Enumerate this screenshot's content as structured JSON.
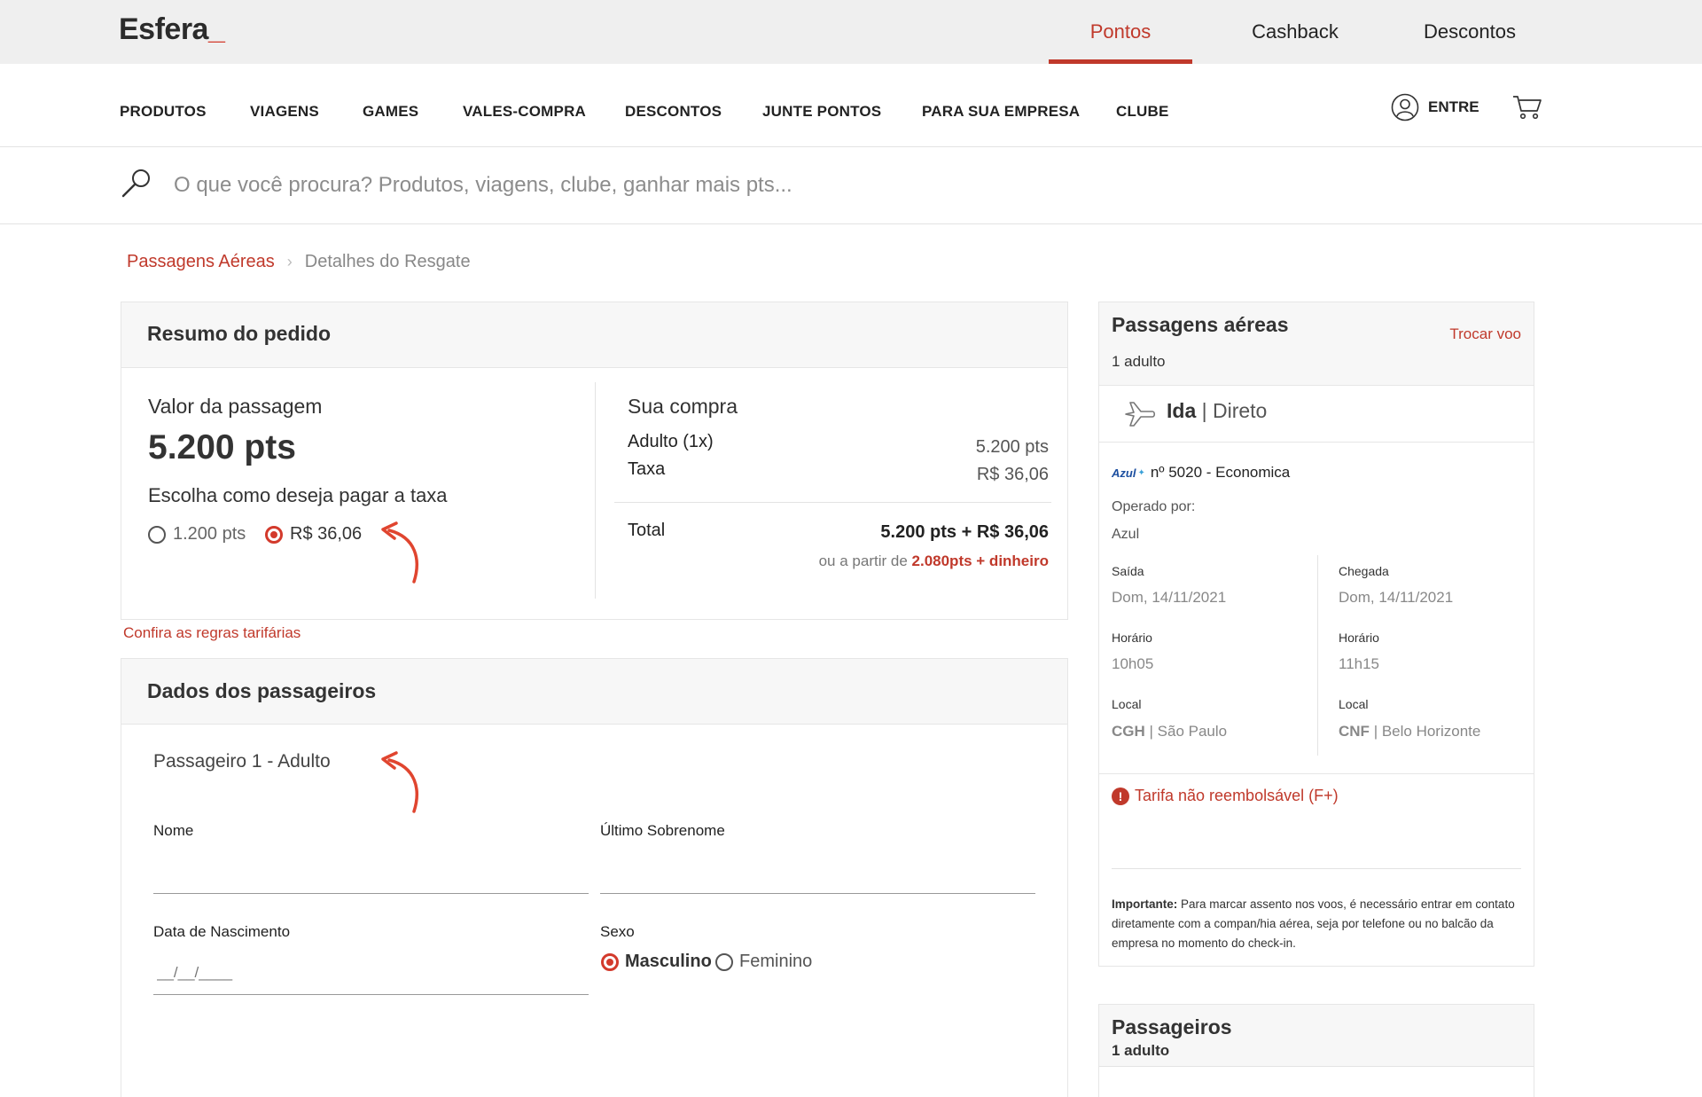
{
  "header": {
    "logo": "Esfera",
    "tabs": [
      {
        "label": "Pontos",
        "active": true
      },
      {
        "label": "Cashback",
        "active": false
      },
      {
        "label": "Descontos",
        "active": false
      }
    ]
  },
  "nav": {
    "items": [
      "PRODUTOS",
      "VIAGENS",
      "GAMES",
      "VALES-COMPRA",
      "DESCONTOS",
      "JUNTE PONTOS",
      "PARA SUA EMPRESA",
      "CLUBE"
    ],
    "login_label": "ENTRE"
  },
  "search": {
    "placeholder": "O que você procura? Produtos, viagens, clube, ganhar mais pts..."
  },
  "breadcrumb": {
    "link": "Passagens Aéreas",
    "current": "Detalhes do Resgate"
  },
  "order_summary": {
    "title": "Resumo do pedido",
    "ticket_value_label": "Valor da passagem",
    "ticket_value": "5.200 pts",
    "fee_prompt": "Escolha como deseja pagar a taxa",
    "fee_options": [
      {
        "label": "1.200 pts",
        "selected": false
      },
      {
        "label": "R$ 36,06",
        "selected": true
      }
    ],
    "purchase_title": "Sua compra",
    "lines": [
      {
        "label": "Adulto (1x)",
        "value": "5.200 pts"
      },
      {
        "label": "Taxa",
        "value": "R$ 36,06"
      }
    ],
    "total_label": "Total",
    "total_value": "5.200 pts + R$ 36,06",
    "alt_prefix": "ou a partir de",
    "alt_value": "2.080pts + dinheiro",
    "fare_rules_link": "Confira as regras tarifárias"
  },
  "passenger_data": {
    "title": "Dados dos passageiros",
    "passenger_label": "Passageiro 1 - Adulto",
    "first_name_label": "Nome",
    "last_name_label": "Último Sobrenome",
    "birth_label": "Data de Nascimento",
    "birth_placeholder": "__/__/____",
    "sex_label": "Sexo",
    "sex_options": [
      {
        "label": "Masculino",
        "selected": true
      },
      {
        "label": "Feminino",
        "selected": false
      }
    ]
  },
  "flight_panel": {
    "title": "Passagens aéreas",
    "change_link": "Trocar voo",
    "passengers": "1 adulto",
    "direction": "Ida",
    "type": "Direto",
    "airline_logo": "Azul",
    "flight_info": "nº 5020 - Economica",
    "operated_label": "Operado por:",
    "operated_value": "Azul",
    "departure": {
      "label": "Saída",
      "date": "Dom, 14/11/2021",
      "time_label": "Horário",
      "time": "10h05",
      "place_label": "Local",
      "code": "CGH",
      "city": "| São Paulo"
    },
    "arrival": {
      "label": "Chegada",
      "date": "Dom, 14/11/2021",
      "time_label": "Horário",
      "time": "11h15",
      "place_label": "Local",
      "code": "CNF",
      "city": "| Belo Horizonte"
    },
    "fare_warning": "Tarifa não reembolsável (F+)",
    "important_label": "Importante:",
    "important_text": "Para marcar assento nos voos, é necessário entrar em contato diretamente com a compan/hia aérea, seja por telefone ou no balcão da empresa no momento do check-in."
  },
  "passengers_panel": {
    "title": "Passageiros",
    "count": "1 adulto"
  },
  "colors": {
    "accent": "#c0392b",
    "top_bar": "#efefef",
    "annotation_arrow": "#e0452f"
  }
}
